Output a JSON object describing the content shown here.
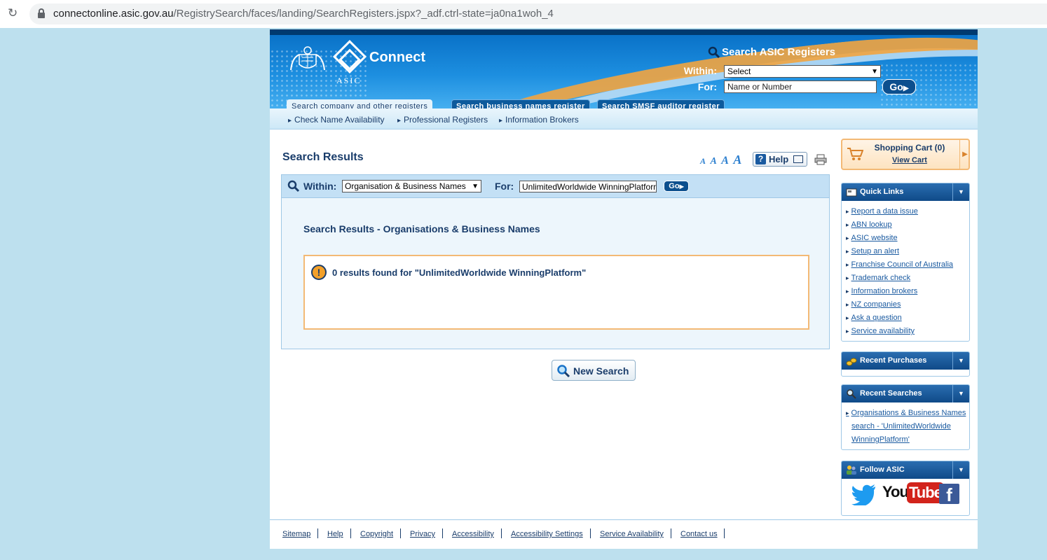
{
  "browser": {
    "url_host": "connectonline.asic.gov.au",
    "url_path": "/RegistrySearch/faces/landing/SearchRegisters.jspx?_adf.ctrl-state=ja0na1woh_4"
  },
  "header": {
    "asic_label": "ASIC",
    "connect_label": "Connect",
    "search_title": "Search ASIC Registers",
    "within_label": "Within:",
    "within_value": "Select",
    "for_label": "For:",
    "for_placeholder": "Name or Number",
    "go_label": "Go"
  },
  "tabs": [
    {
      "label": "Search company and other registers",
      "active": true
    },
    {
      "label": "Search business names register",
      "active": false
    },
    {
      "label": "Search SMSF auditor register",
      "active": false
    }
  ],
  "subnav": [
    "Check Name Availability",
    "Professional Registers",
    "Information Brokers"
  ],
  "main": {
    "title": "Search Results",
    "font_sizes": [
      "A",
      "A",
      "A",
      "A"
    ],
    "help_label": "Help",
    "search": {
      "within_label": "Within:",
      "within_value": "Organisation & Business Names",
      "for_label": "For:",
      "for_value": "UnlimitedWorldwide WinningPlatform",
      "go_label": "Go"
    },
    "results_heading": "Search Results - Organisations & Business Names",
    "results_message": "0 results found for \"UnlimitedWorldwide WinningPlatform\"",
    "new_search_label": "New Search"
  },
  "sidebar": {
    "cart_title": "Shopping Cart (0)",
    "cart_link": "View Cart",
    "quick_links_title": "Quick Links",
    "quick_links": [
      "Report a data issue",
      "ABN lookup",
      "ASIC website",
      "Setup an alert",
      "Franchise Council of Australia",
      "Trademark check",
      "Information brokers",
      "NZ companies",
      "Ask a question",
      "Service availability"
    ],
    "recent_purchases_title": "Recent Purchases",
    "recent_searches_title": "Recent Searches",
    "recent_searches": [
      "Organisations & Business Names",
      "search - 'UnlimitedWorldwide",
      "WinningPlatform'"
    ],
    "follow_title": "Follow ASIC",
    "youtube_a": "You",
    "youtube_b": "Tube",
    "facebook": "f"
  },
  "footer": [
    "Sitemap",
    "Help",
    "Copyright",
    "Privacy",
    "Accessibility",
    "Accessibility Settings",
    "Service Availability",
    "Contact us"
  ],
  "colors": {
    "page_bg": "#bde0ee",
    "banner_blue": "#1d8fe0",
    "navy": "#1a3d6b",
    "accent_orange": "#f3b975",
    "link": "#1a5aa0"
  }
}
